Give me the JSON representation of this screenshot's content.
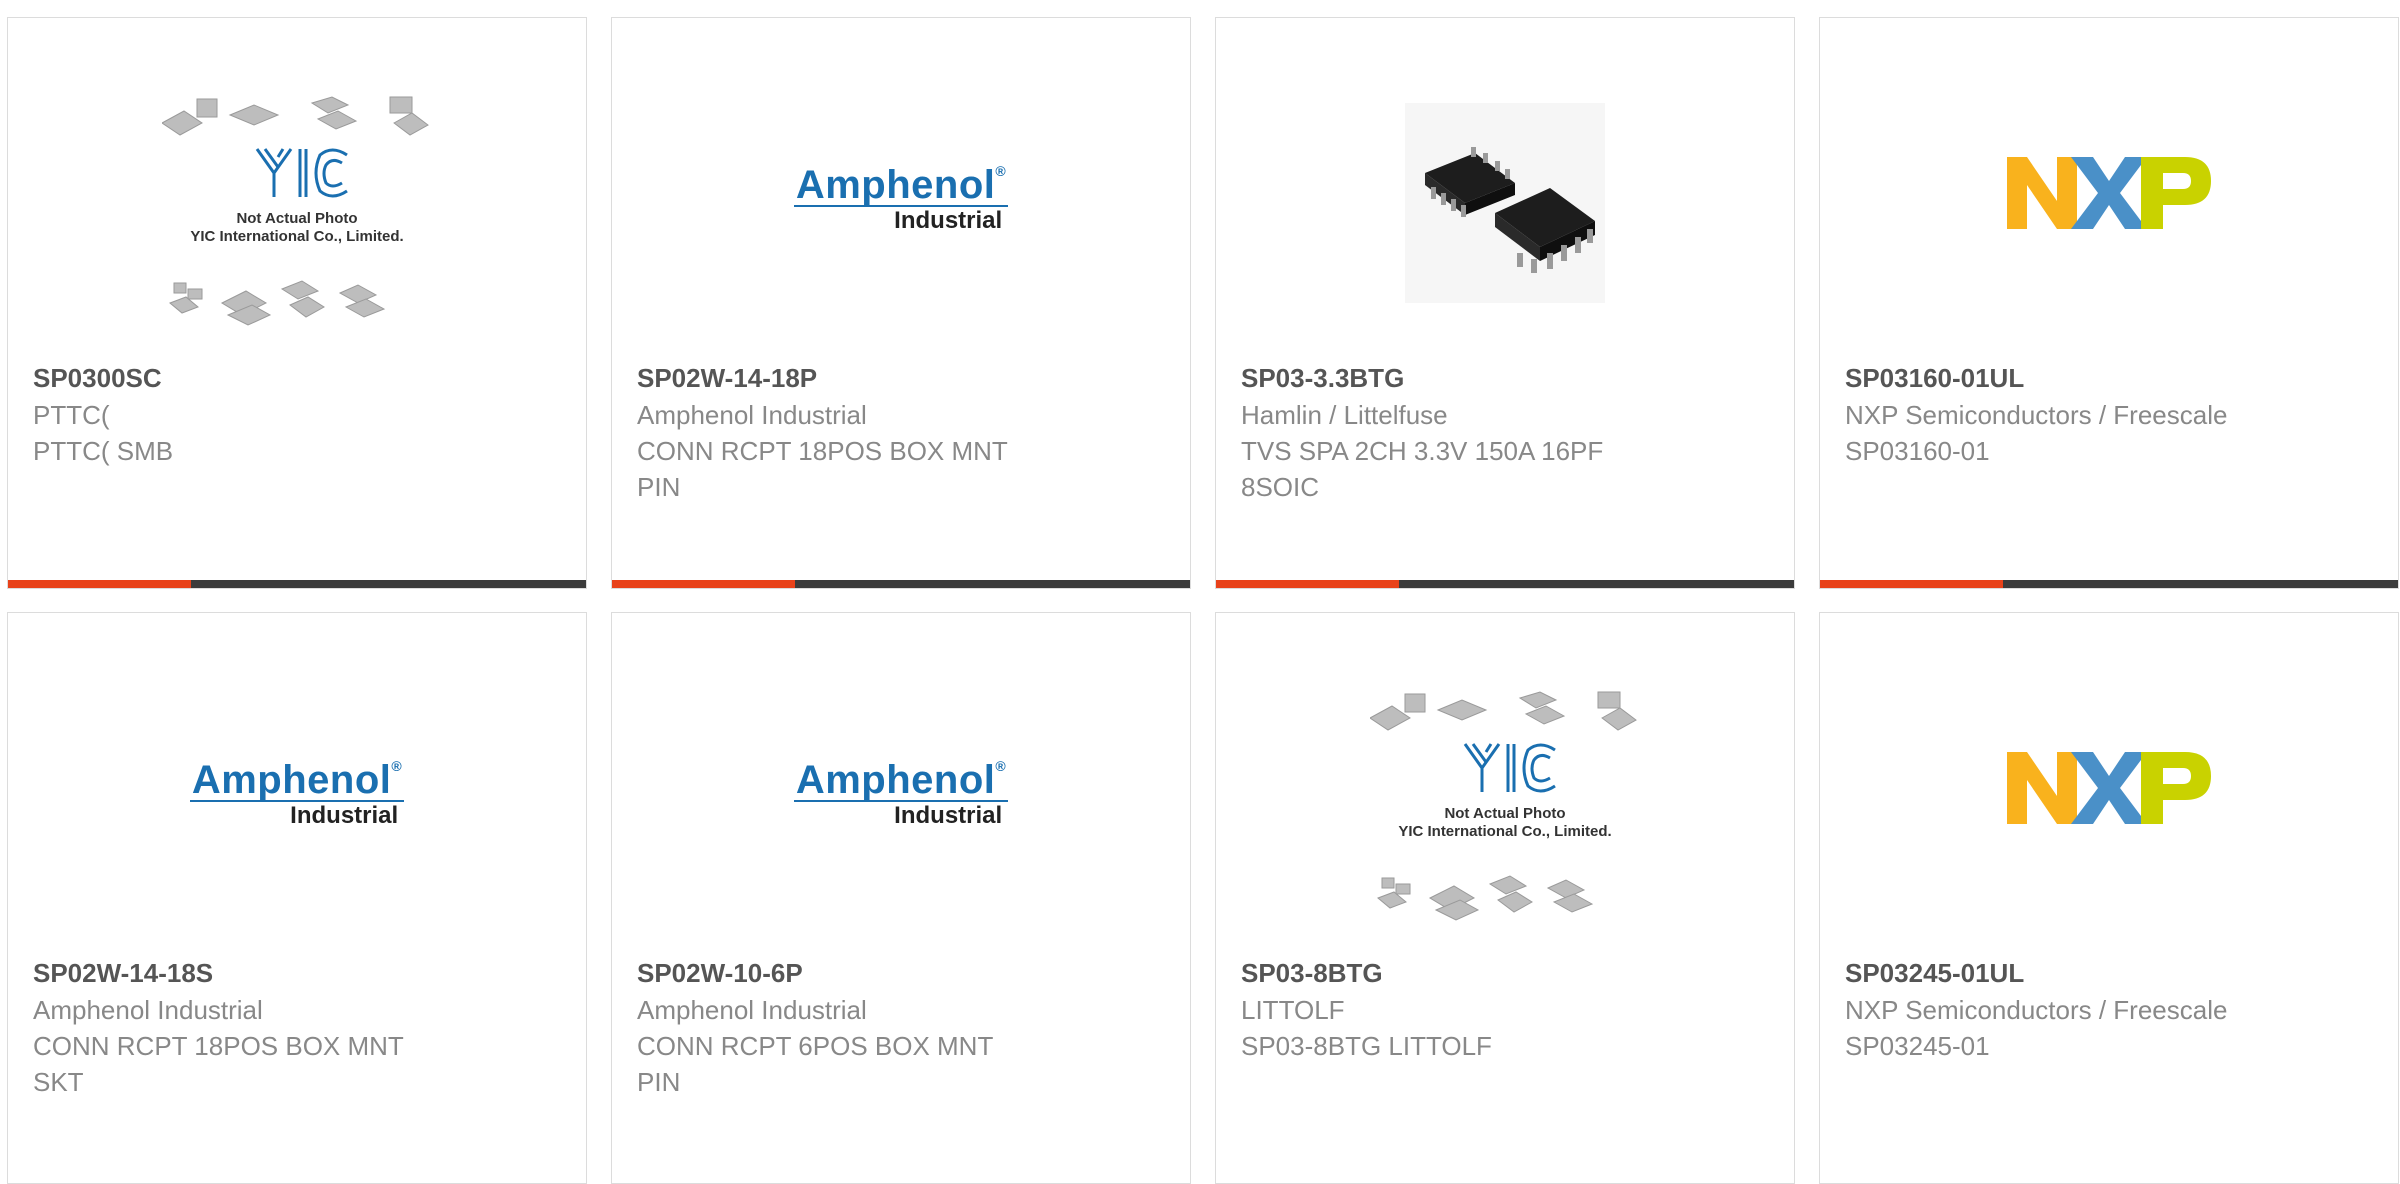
{
  "colors": {
    "accent": "#e8421a",
    "bar_dark": "#3b3b3b",
    "amphenol_blue": "#1a6fb0",
    "nxp_orange": "#f9b21d",
    "nxp_blue": "#4a90c8",
    "nxp_green": "#c9d200"
  },
  "logos": {
    "amphenol_name": "Amphenol",
    "amphenol_sub": "Industrial",
    "yic_text": "YIC",
    "yic_line1": "Not Actual Photo",
    "yic_line2": "YIC International Co., Limited.",
    "nxp_text": "NXP"
  },
  "products": [
    {
      "image": "yic-placeholder",
      "part_number": "SP0300SC",
      "manufacturer": "PTTC(",
      "description": "PTTC( SMB"
    },
    {
      "image": "amphenol-logo",
      "part_number": "SP02W-14-18P",
      "manufacturer": "Amphenol Industrial",
      "description": "CONN RCPT 18POS BOX MNT\nPIN"
    },
    {
      "image": "soic-chip-photo",
      "part_number": "SP03-3.3BTG",
      "manufacturer": "Hamlin / Littelfuse",
      "description": "TVS SPA 2CH 3.3V 150A 16PF\n8SOIC"
    },
    {
      "image": "nxp-logo",
      "part_number": "SP03160-01UL",
      "manufacturer": "NXP Semiconductors / Freescale",
      "description": "SP03160-01"
    },
    {
      "image": "amphenol-logo",
      "part_number": "SP02W-14-18S",
      "manufacturer": "Amphenol Industrial",
      "description": "CONN RCPT 18POS BOX MNT\nSKT"
    },
    {
      "image": "amphenol-logo",
      "part_number": "SP02W-10-6P",
      "manufacturer": "Amphenol Industrial",
      "description": "CONN RCPT 6POS BOX MNT\nPIN"
    },
    {
      "image": "yic-placeholder",
      "part_number": "SP03-8BTG",
      "manufacturer": "LITTOLF",
      "description": "SP03-8BTG LITTOLF"
    },
    {
      "image": "nxp-logo",
      "part_number": "SP03245-01UL",
      "manufacturer": "NXP Semiconductors / Freescale",
      "description": "SP03245-01"
    }
  ]
}
